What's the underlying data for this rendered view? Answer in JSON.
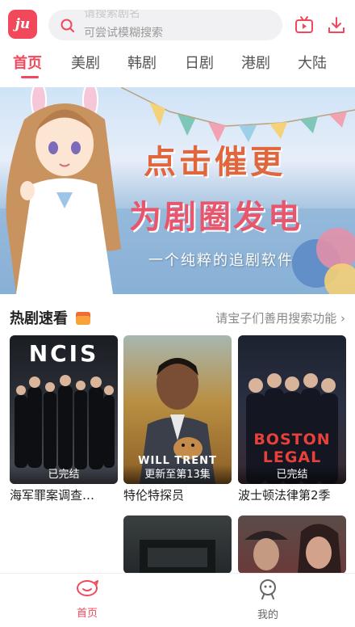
{
  "header": {
    "logo_text": "ju",
    "search_placeholder_prev": "请搜索剧名",
    "search_placeholder": "可尝试模糊搜索"
  },
  "tabs": [
    {
      "label": "首页",
      "active": true
    },
    {
      "label": "美剧",
      "active": false
    },
    {
      "label": "韩剧",
      "active": false
    },
    {
      "label": "日剧",
      "active": false
    },
    {
      "label": "港剧",
      "active": false
    },
    {
      "label": "大陆",
      "active": false
    }
  ],
  "banner": {
    "line1": "点击催更",
    "line2": "为剧圈发电",
    "line3": "一个纯粹的追剧软件"
  },
  "section": {
    "title": "热剧速看",
    "link": "请宝子们善用搜索功能 ›"
  },
  "cards": [
    {
      "poster_text": "NCIS",
      "status": "已完结",
      "title": "海军罪案调查…"
    },
    {
      "poster_text": "WILL TRENT",
      "status": "更新至第13集",
      "title": "特伦特探员"
    },
    {
      "poster_text": "BOSTON LEGAL",
      "status": "已完结",
      "title": "波士顿法律第2季"
    }
  ],
  "bottom_nav": [
    {
      "label": "首页",
      "active": true,
      "icon": "home-icon"
    },
    {
      "label": "我的",
      "active": false,
      "icon": "profile-icon"
    }
  ],
  "colors": {
    "accent": "#f2485c"
  }
}
